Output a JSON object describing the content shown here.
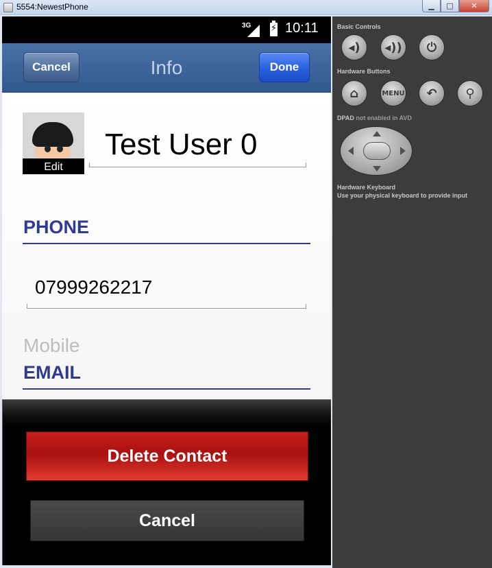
{
  "window": {
    "title": "5554:NewestPhone",
    "minimize_glyph": "▁",
    "maximize_glyph": "□",
    "close_glyph": "✕"
  },
  "statusbar": {
    "network": "3G",
    "battery_glyph": "⚡",
    "time": "10:11"
  },
  "navbar": {
    "cancel_label": "Cancel",
    "title": "Info",
    "done_label": "Done"
  },
  "contact": {
    "edit_label": "Edit",
    "name": "Test User 0",
    "phone_section": "PHONE",
    "phone_number": "07999262217",
    "phone_type": "Mobile",
    "email_section": "EMAIL"
  },
  "action_sheet": {
    "delete_label": "Delete Contact",
    "cancel_label": "Cancel"
  },
  "emulator_panel": {
    "basic_controls": "Basic Controls",
    "hardware_buttons": "Hardware Buttons",
    "dpad_label": "DPAD",
    "dpad_status": "not enabled in AVD",
    "keyboard_title": "Hardware Keyboard",
    "keyboard_hint": "Use your physical keyboard to provide input",
    "volume_down_glyph": "◂)",
    "volume_up_glyph": "◂))",
    "power_glyph": "⏻",
    "home_glyph": "⌂",
    "menu_label": "MENU",
    "back_glyph": "↶",
    "search_glyph": "⚲"
  },
  "colors": {
    "section_accent": "#2f3b8f",
    "delete_red": "#b01515",
    "done_blue": "#2a5fe0"
  }
}
